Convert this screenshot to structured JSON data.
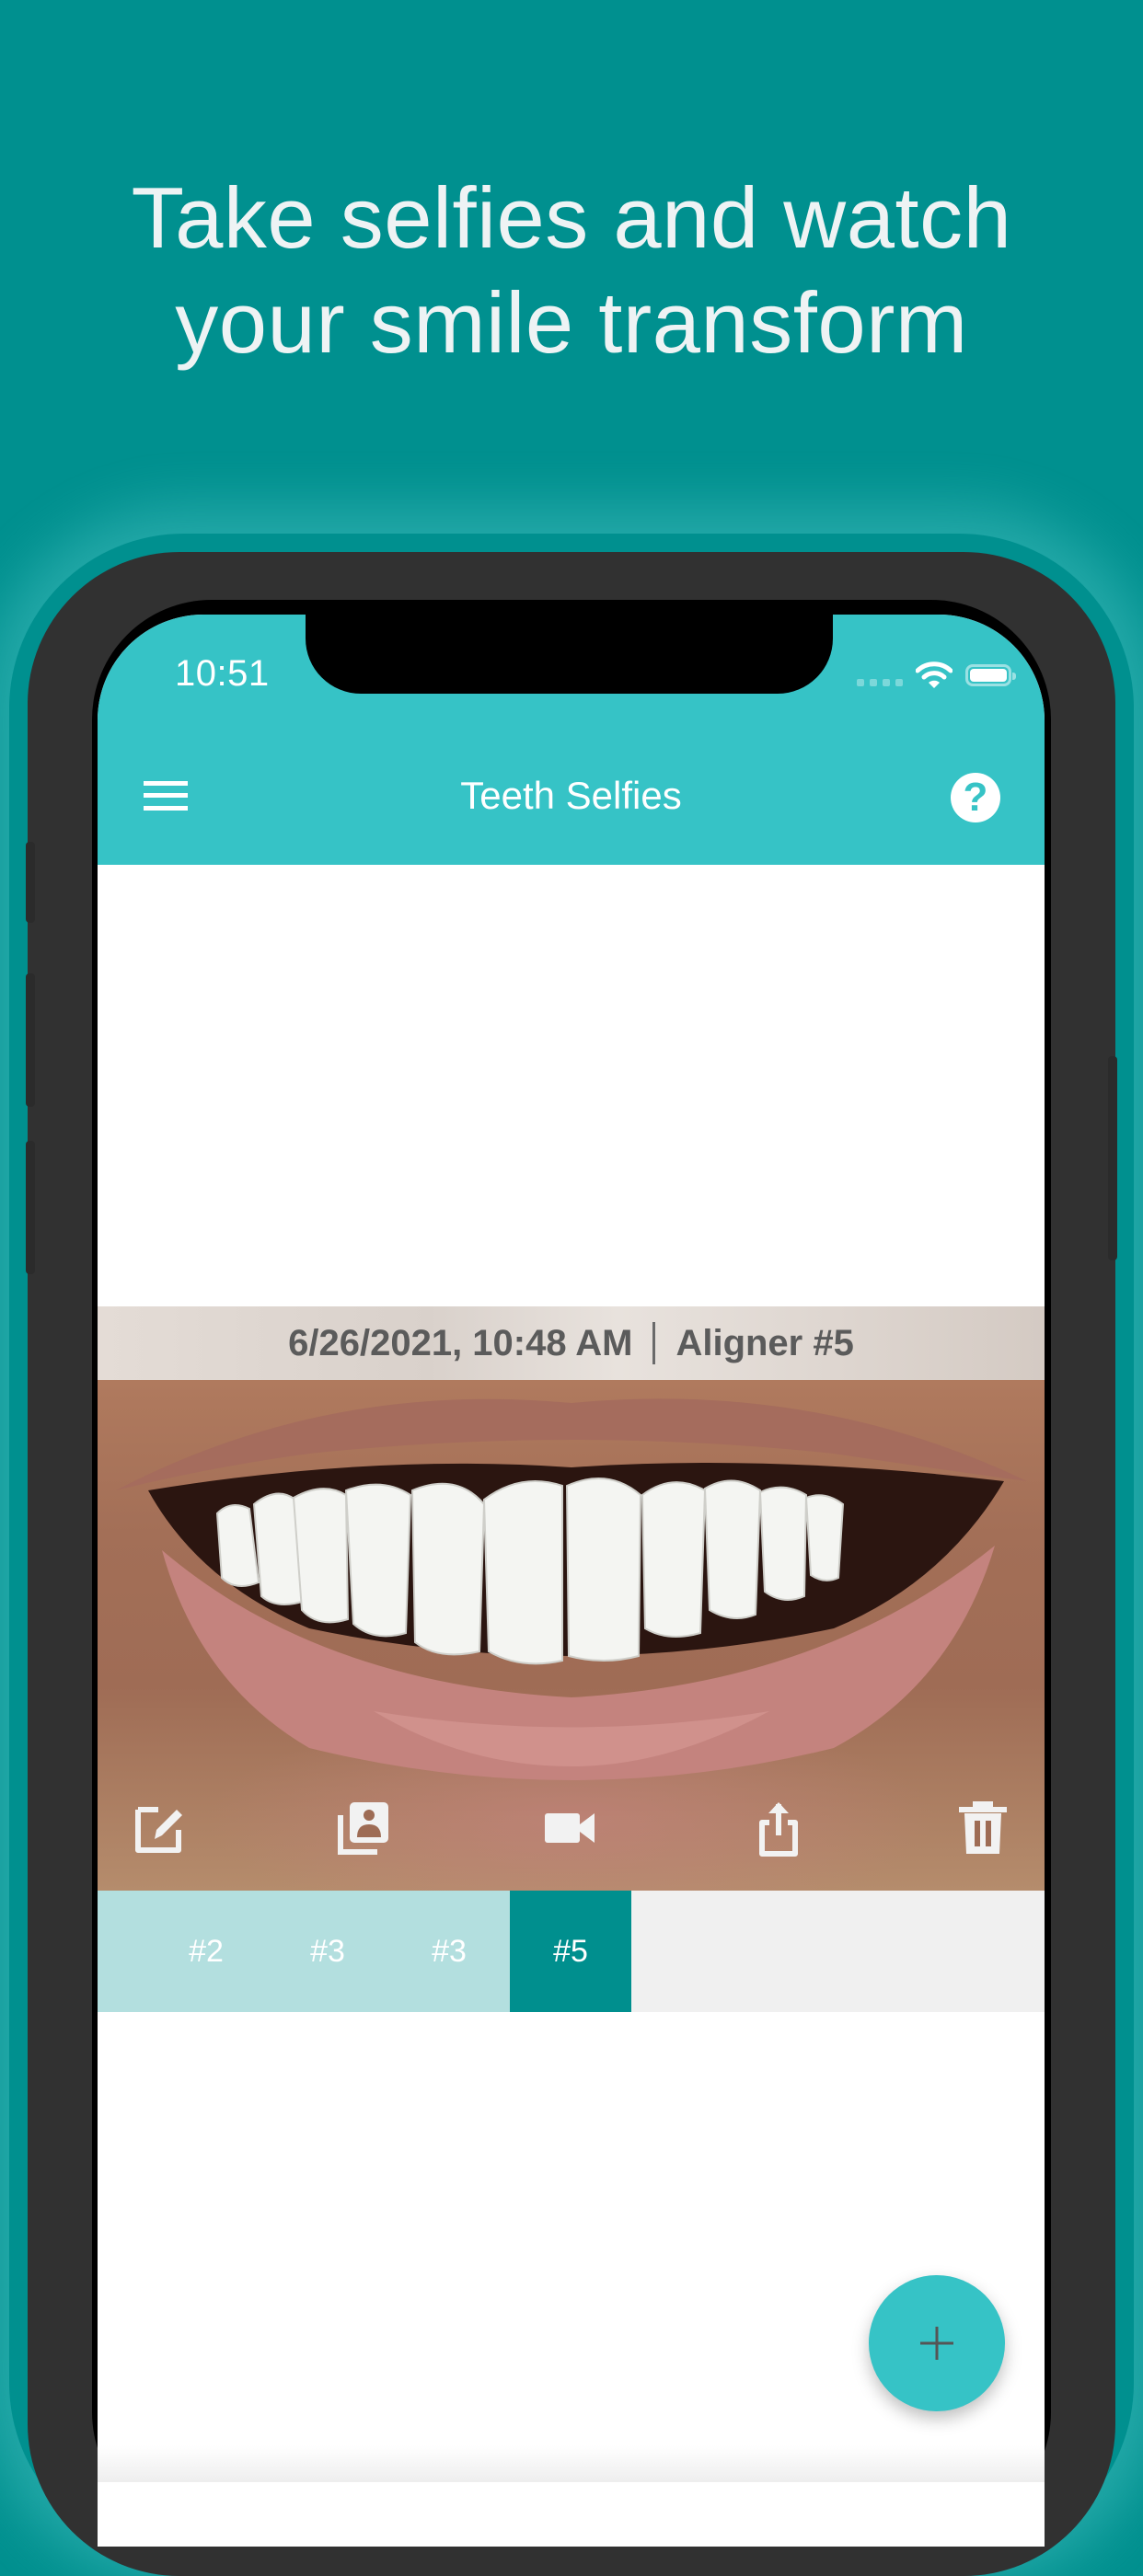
{
  "headline": {
    "line1": "Take selfies and watch",
    "line2": "your smile transform"
  },
  "status_bar": {
    "time": "10:51",
    "icons": [
      "signal-icon",
      "wifi-icon",
      "battery-icon"
    ]
  },
  "navbar": {
    "title": "Teeth Selfies",
    "left_icon": "hamburger-menu-icon",
    "right_icon": "help-icon",
    "help_glyph": "?"
  },
  "selfie": {
    "date": "6/26/2021, 10:48 AM",
    "separator": "|",
    "aligner": "Aligner #5",
    "toolbar": [
      {
        "name": "edit-icon"
      },
      {
        "name": "gallery-icon"
      },
      {
        "name": "video-icon"
      },
      {
        "name": "share-icon"
      },
      {
        "name": "trash-icon"
      }
    ]
  },
  "aligner_tabs": [
    {
      "label": "#2",
      "active": false
    },
    {
      "label": "#3",
      "active": false
    },
    {
      "label": "#3",
      "active": false
    },
    {
      "label": "#5",
      "active": true
    }
  ],
  "fab": {
    "icon": "plus-icon"
  },
  "colors": {
    "background": "#00908f",
    "navbar": "#36c3c6",
    "tab_inactive": "#b3dfdf",
    "tab_active": "#008f8e",
    "tab_strip": "#f0f0f0",
    "phone_body": "#313131"
  }
}
